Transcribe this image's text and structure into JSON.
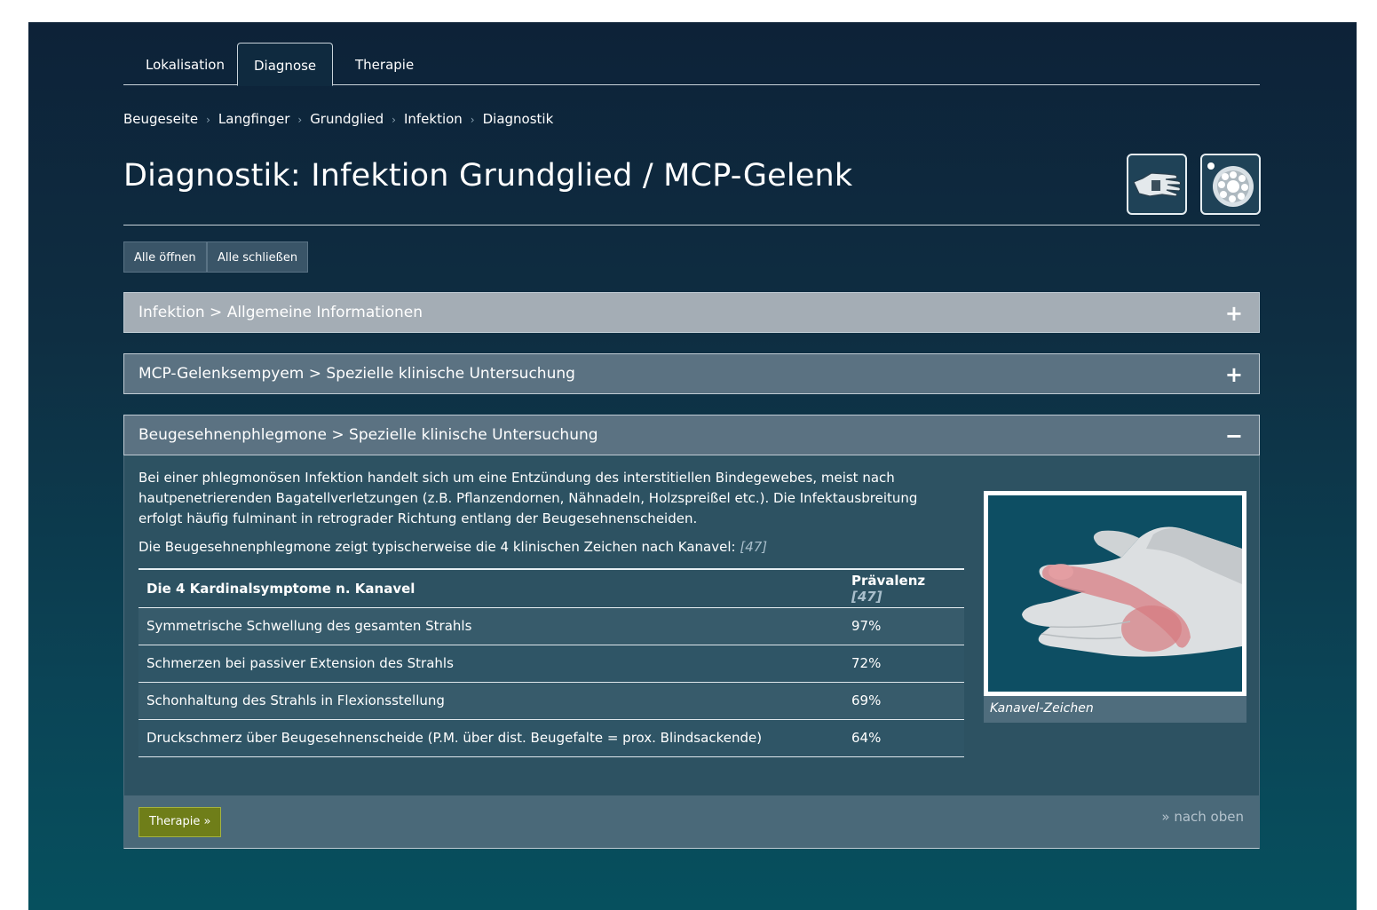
{
  "tabs": [
    {
      "label": "Lokalisation"
    },
    {
      "label": "Diagnose"
    },
    {
      "label": "Therapie"
    }
  ],
  "breadcrumb": [
    "Beugeseite",
    "Langfinger",
    "Grundglied",
    "Infektion",
    "Diagnostik"
  ],
  "breadcrumb_separator": "›",
  "page_title": "Diagnostik: Infektion Grundglied / MCP-Gelenk",
  "icons": [
    "hand-icon",
    "finger-cross-section-icon"
  ],
  "actions": {
    "open_all": "Alle öffnen",
    "close_all": "Alle schließen"
  },
  "panels": [
    {
      "title": "Infektion > Allgemeine Informationen",
      "toggle": "+"
    },
    {
      "title": "MCP-Gelenksempyem > Spezielle klinische Untersuchung",
      "toggle": "+"
    },
    {
      "title": "Beugesehnenphlegmone > Spezielle klinische Untersuchung",
      "toggle": "−"
    }
  ],
  "expanded": {
    "paragraph1": "Bei einer phlegmonösen Infektion handelt sich um eine Entzündung des interstitiellen Bindegewebes, meist nach hautpenetrierenden Bagatellverletzungen (z.B. Pflanzendornen, Nähnadeln, Holzspreißel etc.). Die Infektausbreitung erfolgt häufig fulminant in retrograder Richtung entlang der Beugesehnenscheiden.",
    "paragraph2": "Die Beugesehnenphlegmone zeigt typischerweise die 4 klinischen Zeichen nach Kanavel:",
    "paragraph2_ref": "[47]",
    "table": {
      "header_symptom": "Die 4 Kardinalsymptome n. Kanavel",
      "header_prevalence": "Prävalenz",
      "header_ref": "[47]",
      "rows": [
        {
          "symptom": "Symmetrische Schwellung des gesamten Strahls",
          "prevalence": "97%"
        },
        {
          "symptom": "Schmerzen bei passiver Extension des Strahls",
          "prevalence": "72%"
        },
        {
          "symptom": "Schonhaltung des Strahls in Flexionsstellung",
          "prevalence": "69%"
        },
        {
          "symptom": "Druckschmerz über Beugesehnenscheide (P.M. über dist. Beugefalte = prox. Blindsackende)",
          "prevalence": "64%"
        }
      ]
    },
    "figure_caption": "Kanavel-Zeichen",
    "therapy_button": "Therapie »",
    "back_to_top": "» nach oben"
  },
  "colors": {
    "background_top": "#0d2238",
    "background_bottom": "#06505e",
    "panel_header": "#5b7282",
    "panel_header_active": "#a4adb5",
    "therapy_button": "#6f7e19",
    "inflammation": "#d98a8e"
  }
}
